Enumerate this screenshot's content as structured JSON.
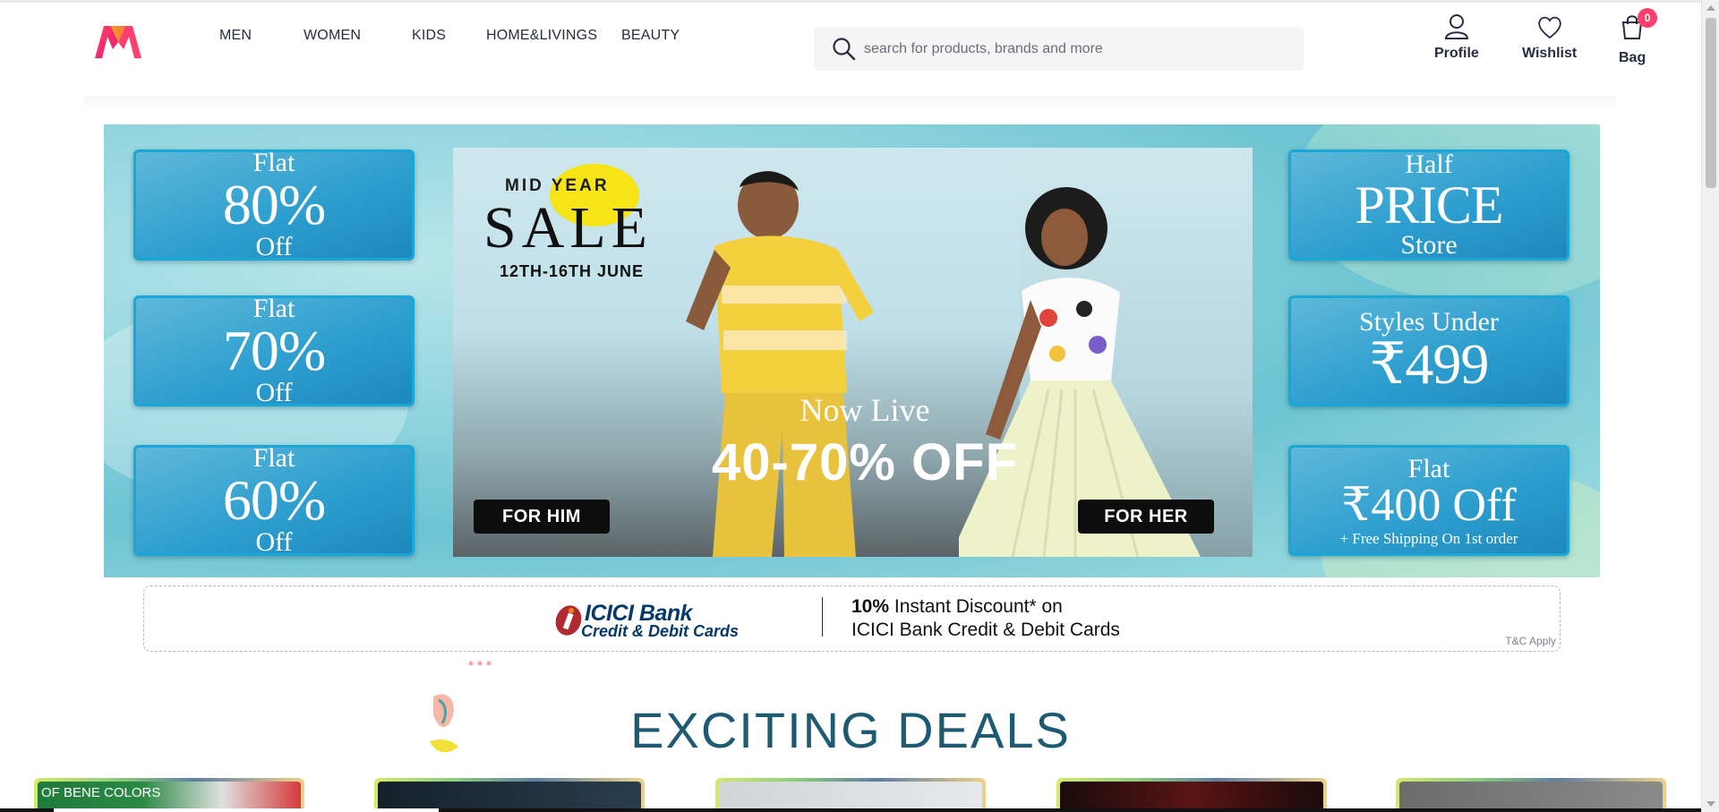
{
  "header": {
    "logo_icon": "myntra-logo",
    "nav": [
      "MEN",
      "WOMEN",
      "KIDS",
      "HOME&LIVINGS",
      "BEAUTY"
    ],
    "search": {
      "icon": "search-icon",
      "placeholder": "search for products, brands and more"
    },
    "actions": {
      "profile": {
        "icon": "person-icon",
        "label": "Profile"
      },
      "wishlist": {
        "icon": "heart-icon",
        "label": "Wishlist"
      },
      "bag": {
        "icon": "bag-icon",
        "label": "Bag",
        "count": "0"
      }
    },
    "brand_colors": {
      "accent": "#ff3f6c",
      "text": "#282c3f"
    }
  },
  "banner": {
    "left_tiles": [
      {
        "top": "Flat",
        "big": "80%",
        "bottom": "Off"
      },
      {
        "top": "Flat",
        "big": "70%",
        "bottom": "Off"
      },
      {
        "top": "Flat",
        "big": "60%",
        "bottom": "Off"
      }
    ],
    "right_tiles": [
      {
        "top": "Half",
        "big": "PRICE",
        "bottom": "Store"
      },
      {
        "top": "Styles Under",
        "big": "₹499",
        "bottom": ""
      },
      {
        "top": "Flat",
        "big": "₹400 Off",
        "bottom": "+ Free Shipping On 1st order"
      }
    ],
    "hero": {
      "sale_mid": "MID YEAR",
      "sale_word": "SALE",
      "sale_date": "12TH-16TH JUNE",
      "live_line1": "Now Live",
      "live_line2": "40-70% OFF",
      "for_him": "FOR HIM",
      "for_her": "FOR HER"
    }
  },
  "offer": {
    "bank_name": "ICICI Bank",
    "bank_sub": "Credit & Debit Cards",
    "discount_bold": "10%",
    "discount_rest": "Instant Discount* on",
    "discount_line2": "ICICI Bank Credit & Debit Cards",
    "tc": "T&C Apply"
  },
  "deals": {
    "title": "EXCITING DEALS",
    "card_label_partial": "OF BENE COLORS"
  }
}
